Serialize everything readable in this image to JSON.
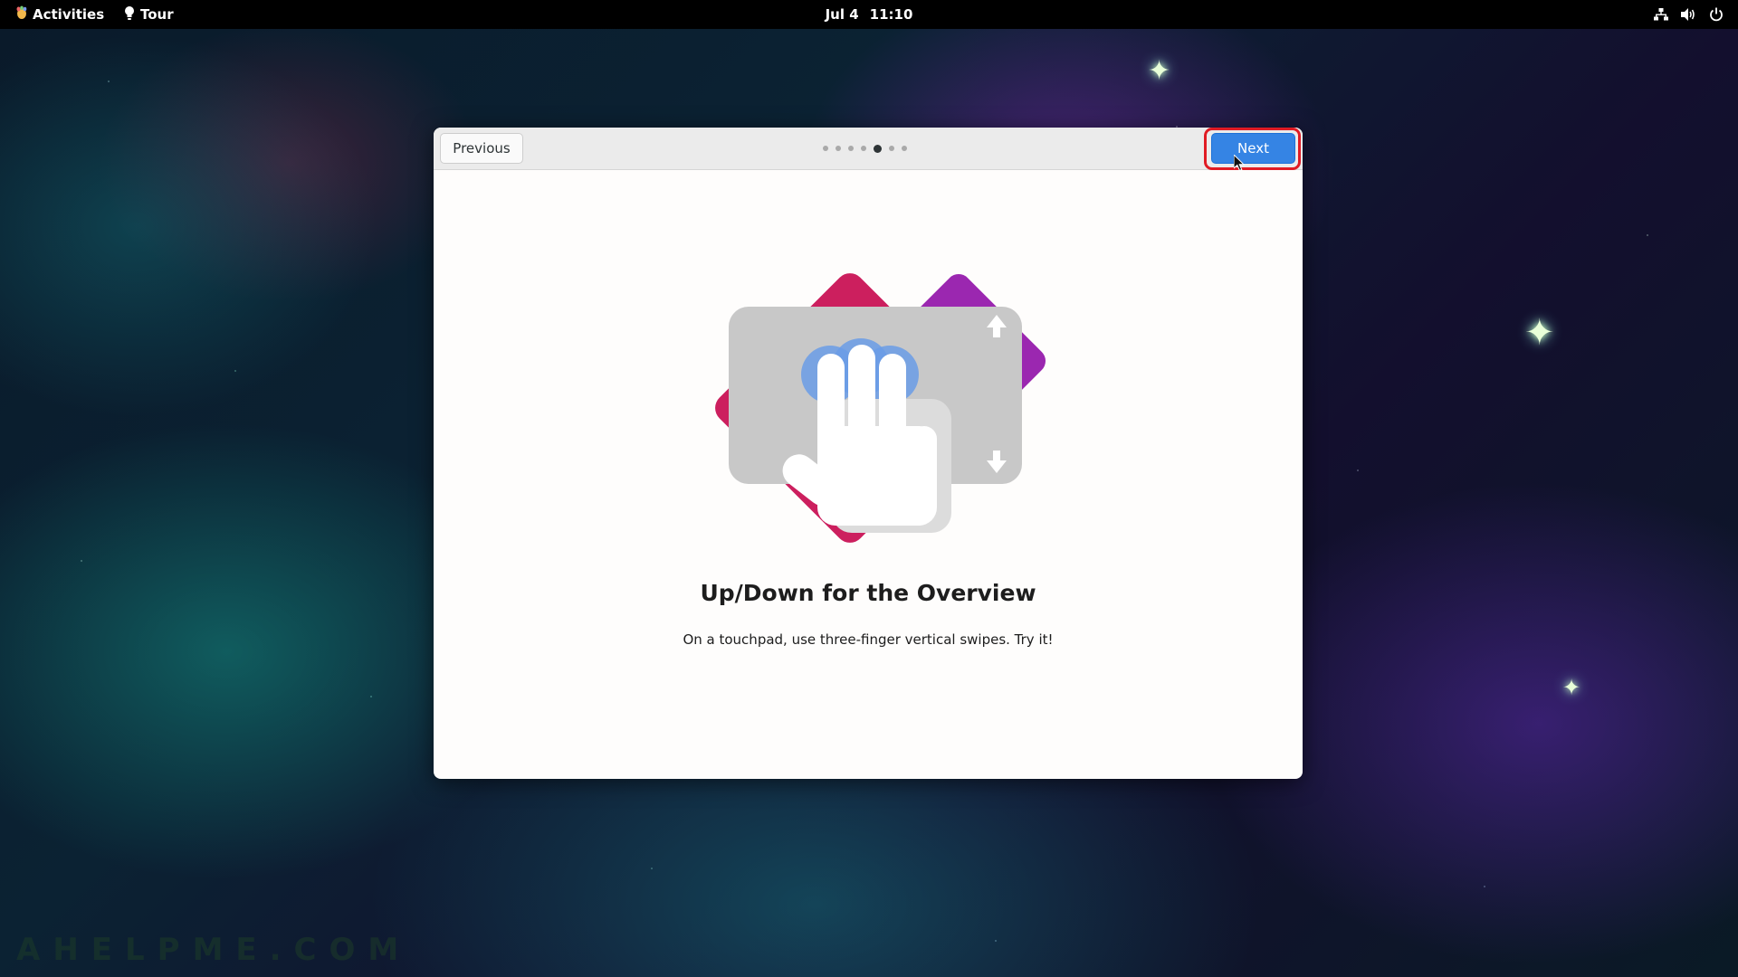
{
  "topbar": {
    "activities_label": "Activities",
    "app_label": "Tour",
    "date": "Jul 4",
    "time": "11:10",
    "icons": [
      "network-wired-icon",
      "volume-icon",
      "power-icon"
    ]
  },
  "window": {
    "previous_label": "Previous",
    "next_label": "Next",
    "page_indicator": {
      "total": 7,
      "current": 5
    },
    "title": "Up/Down for the Overview",
    "description": "On a touchpad, use three-finger vertical swipes. Try it!"
  },
  "watermark": "AHELPME.COM",
  "colors": {
    "accent": "#3584e4",
    "highlight": "#e01b24",
    "illustration_purple": "#9b27b0",
    "illustration_pink": "#cc1f5e",
    "touchpad_gray": "#c8c8c8"
  }
}
